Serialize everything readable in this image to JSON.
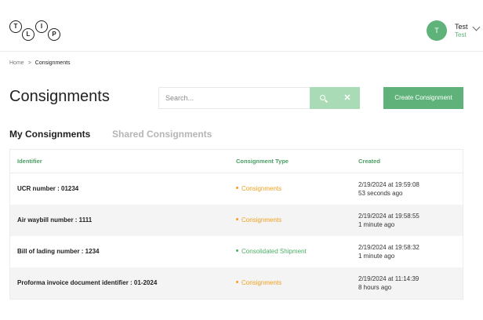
{
  "header": {
    "logo_letters": [
      "T",
      "L",
      "I",
      "P"
    ],
    "avatar_initial": "T",
    "user_name": "Test",
    "user_role": "Test"
  },
  "breadcrumb": {
    "home": "Home",
    "separator": ">",
    "current": "Consignments"
  },
  "page": {
    "title": "Consignments",
    "search_placeholder": "Search...",
    "search_value": "",
    "create_button": "Create Consignment"
  },
  "tabs": [
    {
      "label": "My Consignments",
      "active": true
    },
    {
      "label": "Shared Consignments",
      "active": false
    }
  ],
  "table": {
    "columns": [
      "Identifier",
      "Consignment Type",
      "Created"
    ],
    "rows": [
      {
        "identifier": "UCR number : 01234",
        "type": "Consignments",
        "type_color": "#f0a020",
        "date": "2/19/2024 at 19:59:08",
        "ago": "53 seconds ago"
      },
      {
        "identifier": "Air waybill number : 1111",
        "type": "Consignments",
        "type_color": "#f0a020",
        "date": "2/19/2024 at 19:58:55",
        "ago": "1 minute ago"
      },
      {
        "identifier": "Bill of lading number : 1234",
        "type": "Consolidated Shipment",
        "type_color": "#4caf66",
        "date": "2/19/2024 at 19:58:32",
        "ago": "1 minute ago"
      },
      {
        "identifier": "Proforma invoice document identifier : 01-2024",
        "type": "Consignments",
        "type_color": "#f0a020",
        "date": "2/19/2024 at 11:14:39",
        "ago": "8 hours ago"
      }
    ]
  },
  "colors": {
    "brand_green": "#5fb37a",
    "search_button": "#a9dcb6",
    "header_text": "#4a9e63"
  },
  "icons": {
    "search": "search-icon",
    "clear": "close-icon",
    "dropdown": "chevron-down-icon"
  }
}
